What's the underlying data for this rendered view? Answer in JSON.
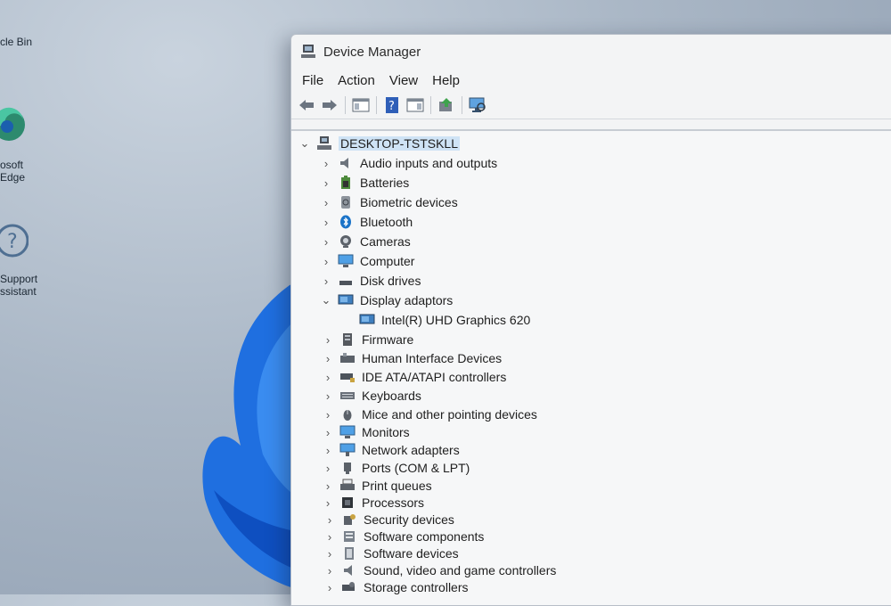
{
  "desktop": {
    "icons": [
      {
        "name": "bin-icon",
        "label": "cle Bin"
      },
      {
        "name": "edge-icon",
        "label": "osoft\nEdge"
      },
      {
        "name": "support-icon",
        "label": "Support\nssistant"
      }
    ]
  },
  "window": {
    "title": "Device Manager",
    "menu": [
      "File",
      "Action",
      "View",
      "Help"
    ],
    "tree": {
      "root": "DESKTOP-TSTSKLL",
      "categories": [
        {
          "label": "Audio inputs and outputs",
          "icon": "speaker-icon",
          "expanded": false
        },
        {
          "label": "Batteries",
          "icon": "battery-icon",
          "expanded": false
        },
        {
          "label": "Biometric devices",
          "icon": "fingerprint-icon",
          "expanded": false
        },
        {
          "label": "Bluetooth",
          "icon": "bluetooth-icon",
          "expanded": false
        },
        {
          "label": "Cameras",
          "icon": "camera-icon",
          "expanded": false
        },
        {
          "label": "Computer",
          "icon": "computer-icon",
          "expanded": false
        },
        {
          "label": "Disk drives",
          "icon": "disk-icon",
          "expanded": false
        },
        {
          "label": "Display adaptors",
          "icon": "display-icon",
          "expanded": true,
          "children": [
            "Intel(R) UHD Graphics 620"
          ]
        },
        {
          "label": "Firmware",
          "icon": "firmware-icon",
          "expanded": false
        },
        {
          "label": "Human Interface Devices",
          "icon": "hid-icon",
          "expanded": false
        },
        {
          "label": "IDE ATA/ATAPI controllers",
          "icon": "ide-icon",
          "expanded": false
        },
        {
          "label": "Keyboards",
          "icon": "keyboard-icon",
          "expanded": false
        },
        {
          "label": "Mice and other pointing devices",
          "icon": "mouse-icon",
          "expanded": false
        },
        {
          "label": "Monitors",
          "icon": "monitor-icon",
          "expanded": false
        },
        {
          "label": "Network adapters",
          "icon": "network-icon",
          "expanded": false
        },
        {
          "label": "Ports (COM & LPT)",
          "icon": "port-icon",
          "expanded": false
        },
        {
          "label": "Print queues",
          "icon": "printer-icon",
          "expanded": false
        },
        {
          "label": "Processors",
          "icon": "cpu-icon",
          "expanded": false
        },
        {
          "label": "Security devices",
          "icon": "security-icon",
          "expanded": false
        },
        {
          "label": "Software components",
          "icon": "software-component-icon",
          "expanded": false
        },
        {
          "label": "Software devices",
          "icon": "software-device-icon",
          "expanded": false
        },
        {
          "label": "Sound, video and game controllers",
          "icon": "sound-icon",
          "expanded": false
        },
        {
          "label": "Storage controllers",
          "icon": "storage-icon",
          "expanded": false
        }
      ]
    }
  },
  "colors": {
    "selection": "#cfe3f5",
    "accent": "#1a73c8",
    "bloom": "#1e6fe0"
  }
}
